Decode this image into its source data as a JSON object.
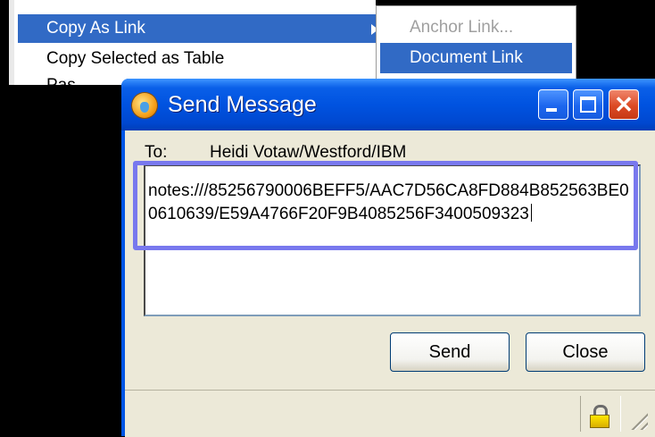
{
  "context_menu": {
    "items": [
      {
        "label": "Copy As Link",
        "selected": true,
        "has_submenu": true
      },
      {
        "label": "Copy Selected as Table",
        "selected": false,
        "has_submenu": false
      }
    ],
    "partial_item": "Pas..."
  },
  "submenu": {
    "items": [
      {
        "label": "Anchor Link...",
        "disabled": true
      },
      {
        "label": "Document Link",
        "selected": true
      }
    ]
  },
  "dialog": {
    "title": "Send Message",
    "to_label": "To:",
    "to_value": "Heidi Votaw/Westford/IBM",
    "message": "notes:///85256790006BEFF5/AAC7D56CA8FD884B852563BE00610639/E59A4766F20F9B4085256F3400509323",
    "send_label": "Send",
    "close_label": "Close"
  },
  "colors": {
    "menu_selection": "#316ac5",
    "title_bar": "#0053e0",
    "highlight_box": "#7878ee",
    "dialog_face": "#ece9d8",
    "close_button": "#dc4a24"
  },
  "icons": {
    "title": "lotus-notes-globe-icon",
    "status": "lock-icon",
    "submenu_indicator": "chevron-right-icon"
  }
}
